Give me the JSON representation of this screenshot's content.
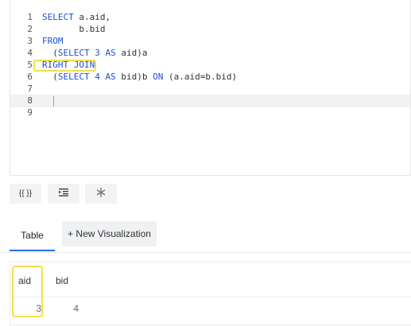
{
  "editor": {
    "line_numbers": [
      "1",
      "2",
      "3",
      "4",
      "5",
      "6",
      "7",
      "8",
      "9"
    ],
    "lines": [
      [
        {
          "t": "SELECT",
          "c": "kw"
        },
        {
          "t": " a.aid,",
          "c": ""
        }
      ],
      [
        {
          "t": "       b.bid",
          "c": ""
        }
      ],
      [
        {
          "t": "FROM",
          "c": "kw"
        }
      ],
      [
        {
          "t": "  (",
          "c": ""
        },
        {
          "t": "SELECT",
          "c": "kw"
        },
        {
          "t": " ",
          "c": ""
        },
        {
          "t": "3",
          "c": "num"
        },
        {
          "t": " ",
          "c": ""
        },
        {
          "t": "AS",
          "c": "kw"
        },
        {
          "t": " aid)a",
          "c": ""
        }
      ],
      [
        {
          "t": "RIGHT JOIN",
          "c": "kw"
        }
      ],
      [
        {
          "t": "  (",
          "c": ""
        },
        {
          "t": "SELECT",
          "c": "kw"
        },
        {
          "t": " ",
          "c": ""
        },
        {
          "t": "4",
          "c": "num"
        },
        {
          "t": " ",
          "c": ""
        },
        {
          "t": "AS",
          "c": "kw"
        },
        {
          "t": " bid)b ",
          "c": ""
        },
        {
          "t": "ON",
          "c": "kw"
        },
        {
          "t": " (a.aid=b.bid)",
          "c": ""
        }
      ],
      [],
      [],
      []
    ]
  },
  "toolbar": {
    "format_label": "{{ }}",
    "indent_label": "⇥",
    "autocomplete_label": "⁑"
  },
  "tabs": {
    "table_label": "Table",
    "new_vis_label": "+ New Visualization"
  },
  "results": {
    "columns": [
      "aid",
      "bid"
    ],
    "rows": [
      [
        "3",
        "4"
      ]
    ]
  },
  "colors": {
    "keyword": "#1e4fd6",
    "highlight": "#f2e04b",
    "active_tab": "#2a6cdf"
  }
}
